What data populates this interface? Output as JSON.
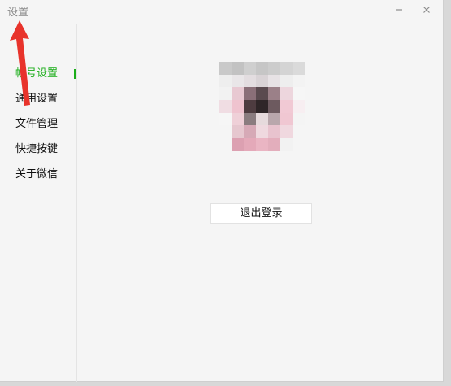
{
  "window": {
    "title": "设置"
  },
  "sidebar": {
    "items": [
      {
        "label": "帐号设置",
        "active": true
      },
      {
        "label": "通用设置",
        "active": false
      },
      {
        "label": "文件管理",
        "active": false
      },
      {
        "label": "快捷按键",
        "active": false
      },
      {
        "label": "关于微信",
        "active": false
      }
    ]
  },
  "main": {
    "logout_label": "退出登录"
  },
  "colors": {
    "accent": "#1aad19",
    "annotation_arrow": "#e8332b",
    "background": "#f5f5f5"
  },
  "icons": {
    "minimize": "minimize-icon",
    "close": "close-icon"
  }
}
